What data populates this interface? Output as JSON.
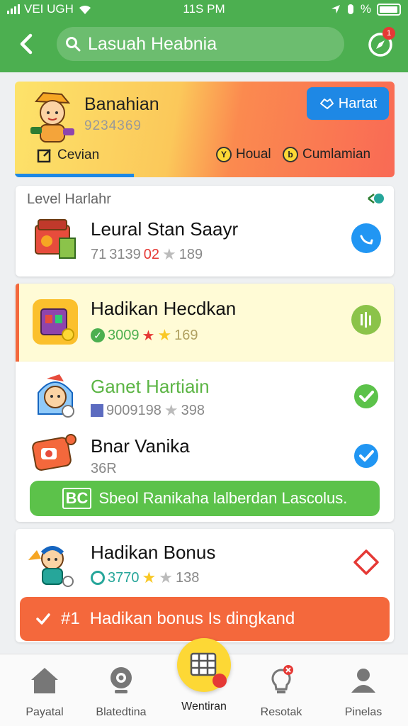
{
  "status_bar": {
    "carrier": "VEI UGH",
    "time": "11S PM",
    "battery_label": "%"
  },
  "header": {
    "search_value": "Lasuah Heabnia",
    "notification_count": "1",
    "accent_color": "#4caf50"
  },
  "banner": {
    "name": "Banahian",
    "code": "9234369",
    "action_label": "Hartat",
    "link_left": "Cevian",
    "link_mid": "Houal",
    "link_right": "Cumlamian",
    "coin_y": "Y",
    "coin_b": "b"
  },
  "level_section": {
    "label": "Level Harlahr",
    "items": [
      {
        "title": "Leural Stan Saayr",
        "meta_prefix": "71",
        "meta_value": "3139",
        "meta_red": "02",
        "meta_end": "189",
        "icon": "folder-icon",
        "action_icon": "phone-icon"
      },
      {
        "title": "Hadikan Hecdkan",
        "meta_value": "3009",
        "meta_end": "169",
        "icon": "gift-box-icon",
        "action_icon": "equalizer-icon"
      }
    ]
  },
  "games_section": {
    "items": [
      {
        "title": "Ganet Hartiain",
        "meta_value": "9009198",
        "meta_end": "398",
        "icon": "girl-avatar-icon",
        "action_icon": "check-icon"
      },
      {
        "title": "Bnar Vanika",
        "meta_value": "36R",
        "icon": "badge-icon",
        "action_icon": "check-icon"
      }
    ],
    "green_bar_label": "Sbeol Ranikaha lalberdan Lascolus.",
    "green_bar_code": "BC"
  },
  "bonus_section": {
    "title": "Hadikan Bonus",
    "meta_value": "3770",
    "meta_end": "138",
    "orange_bar_label": "Hadikan bonus Is dingkand",
    "orange_bar_code": "#1"
  },
  "bottom_nav": {
    "items": [
      {
        "label": "Payatal",
        "icon": "home-icon"
      },
      {
        "label": "Blatedtina",
        "icon": "webcam-icon"
      },
      {
        "label": "Wentiran",
        "icon": "grid-icon"
      },
      {
        "label": "Resotak",
        "icon": "lightbulb-icon"
      },
      {
        "label": "Pinelas",
        "icon": "person-icon"
      }
    ]
  }
}
